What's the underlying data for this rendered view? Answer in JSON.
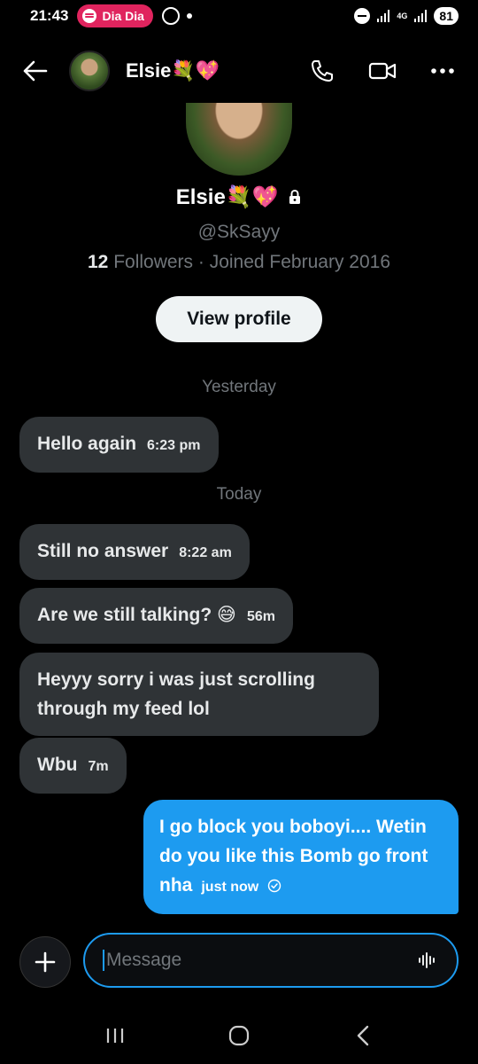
{
  "status_bar": {
    "time": "21:43",
    "spotify_label": "Dia Dia",
    "network": "4G",
    "battery": "81"
  },
  "header": {
    "name": "Elsie💐💖"
  },
  "profile": {
    "name": "Elsie💐💖",
    "handle": "@SkSayy",
    "followers_count": "12",
    "followers_label": "Followers · Joined February 2016",
    "view_profile_label": "View profile"
  },
  "days": {
    "yesterday": "Yesterday",
    "today": "Today"
  },
  "messages": [
    {
      "text": "Hello again",
      "time": "6:23 pm"
    },
    {
      "text": "Still no answer",
      "time": "8:22 am"
    },
    {
      "text": "Are we still talking? 😅",
      "time": "56m"
    },
    {
      "text": "Heyyy sorry i was just scrolling through my feed lol",
      "time": ""
    },
    {
      "text": "Wbu",
      "time": "7m"
    }
  ],
  "sent_message": {
    "text": "I go block you boboyi.... Wetin do you like this Bomb go front nha",
    "time": "just now"
  },
  "composer": {
    "placeholder": "Message"
  },
  "colors": {
    "accent": "#1d9bf0",
    "received_bubble": "#2f3336",
    "background": "#000000"
  }
}
